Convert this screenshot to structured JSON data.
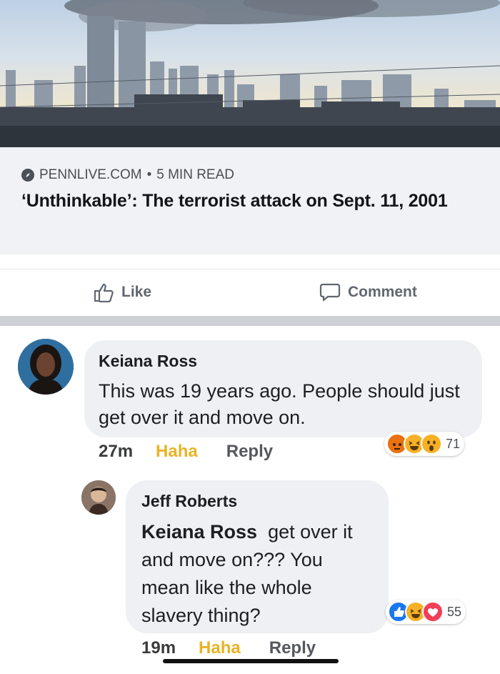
{
  "link_preview": {
    "source": "PENNLIVE.COM",
    "separator": "•",
    "read_time": "5 MIN READ",
    "headline": "‘Unthinkable’: The terrorist attack on Sept. 11, 2001"
  },
  "actions": {
    "like_label": "Like",
    "comment_label": "Comment"
  },
  "comments": [
    {
      "author": "Keiana Ross",
      "text": "This was 19 years ago. People should just get over it and move on.",
      "time": "27m",
      "haha_label": "Haha",
      "reply_label": "Reply",
      "reaction_icons": [
        "angry-icon",
        "haha-icon",
        "wow-icon"
      ],
      "reaction_count": "71"
    },
    {
      "author": "Jeff Roberts",
      "mention": "Keiana Ross",
      "text": "get over it and move on??? You mean like the whole slavery thing?",
      "time": "19m",
      "haha_label": "Haha",
      "reply_label": "Reply",
      "reaction_icons": [
        "like-icon",
        "haha-icon",
        "love-icon"
      ],
      "reaction_count": "55"
    }
  ],
  "colors": {
    "haha_active": "#e8b425",
    "like_blue": "#1877f2",
    "love_red": "#f33e58",
    "angry_orange": "#e9710f",
    "reaction_yellow": "#f7b125"
  }
}
